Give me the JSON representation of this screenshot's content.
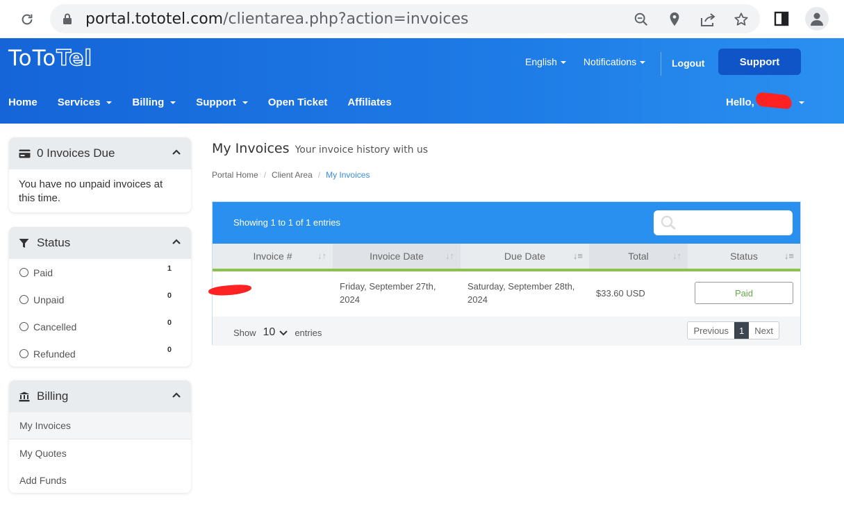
{
  "browser": {
    "url_host": "portal.tototel.com",
    "url_path": "/clientarea.php?action=invoices"
  },
  "header": {
    "logo_main": "ToTo",
    "logo_accent": "Tel",
    "language": "English",
    "notifications": "Notifications",
    "logout": "Logout",
    "support_button": "Support",
    "hello": "Hello,",
    "nav": [
      "Home",
      "Services",
      "Billing",
      "Support",
      "Open Ticket",
      "Affiliates"
    ]
  },
  "sidebar": {
    "invoices_due": {
      "title": "0 Invoices Due",
      "body": "You have no unpaid invoices at this time."
    },
    "status": {
      "title": "Status",
      "items": [
        {
          "label": "Paid",
          "count": "1"
        },
        {
          "label": "Unpaid",
          "count": "0"
        },
        {
          "label": "Cancelled",
          "count": "0"
        },
        {
          "label": "Refunded",
          "count": "0"
        }
      ]
    },
    "billing": {
      "title": "Billing",
      "items": [
        "My Invoices",
        "My Quotes",
        "Add Funds"
      ]
    }
  },
  "main": {
    "title": "My Invoices",
    "subtitle": "Your invoice history with us",
    "breadcrumb": [
      "Portal Home",
      "Client Area",
      "My Invoices"
    ],
    "showing": "Showing 1 to 1 of 1 entries",
    "columns": [
      "Invoice #",
      "Invoice Date",
      "Due Date",
      "Total",
      "Status"
    ],
    "rows": [
      {
        "invoice_date": "Friday, September 27th, 2024",
        "due_date": "Saturday, September 28th, 2024",
        "total": "$33.60 USD",
        "status": "Paid"
      }
    ],
    "footer": {
      "show": "Show",
      "page_size": "10",
      "entries": "entries",
      "previous": "Previous",
      "page": "1",
      "next": "Next"
    }
  }
}
